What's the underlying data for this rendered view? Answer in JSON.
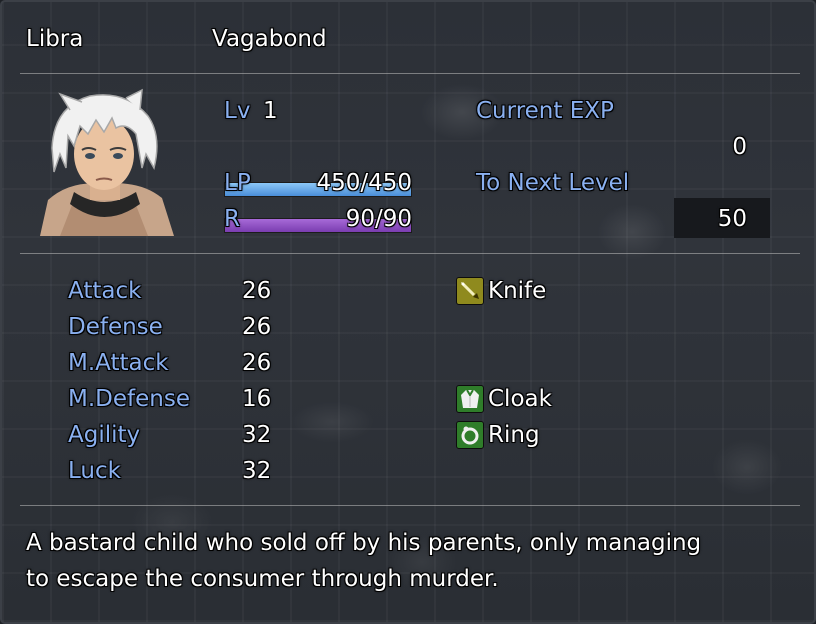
{
  "actor": {
    "name": "Libra",
    "class": "Vagabond",
    "level_label": "Lv",
    "level": "1",
    "hp_label": "LP",
    "hp_text": "450/450",
    "hp_fraction": 1.0,
    "mp_label": "R",
    "mp_text": "90/90",
    "mp_fraction": 1.0
  },
  "exp": {
    "current_label": "Current EXP",
    "current_value": "0",
    "next_label": "To Next Level",
    "next_value": "50"
  },
  "params": [
    {
      "label": "Attack",
      "value": "26"
    },
    {
      "label": "Defense",
      "value": "26"
    },
    {
      "label": "M.Attack",
      "value": "26"
    },
    {
      "label": "M.Defense",
      "value": "16"
    },
    {
      "label": "Agility",
      "value": "32"
    },
    {
      "label": "Luck",
      "value": "32"
    }
  ],
  "equipment": [
    {
      "name": "Knife",
      "icon": "knife-icon"
    },
    {
      "name": "",
      "icon": ""
    },
    {
      "name": "",
      "icon": ""
    },
    {
      "name": "Cloak",
      "icon": "cloak-icon"
    },
    {
      "name": "Ring",
      "icon": "ring-icon"
    }
  ],
  "profile": {
    "line1": "A bastard child who sold off by his parents, only managing",
    "line2": "to escape the consumer through murder."
  },
  "colors": {
    "system_text": "#8ab0f0",
    "hp_gauge": "#5aa6e8",
    "mp_gauge": "#8b4ec4",
    "icon_weapon": "#8f8a1e",
    "icon_armor": "#2f7d2a"
  }
}
